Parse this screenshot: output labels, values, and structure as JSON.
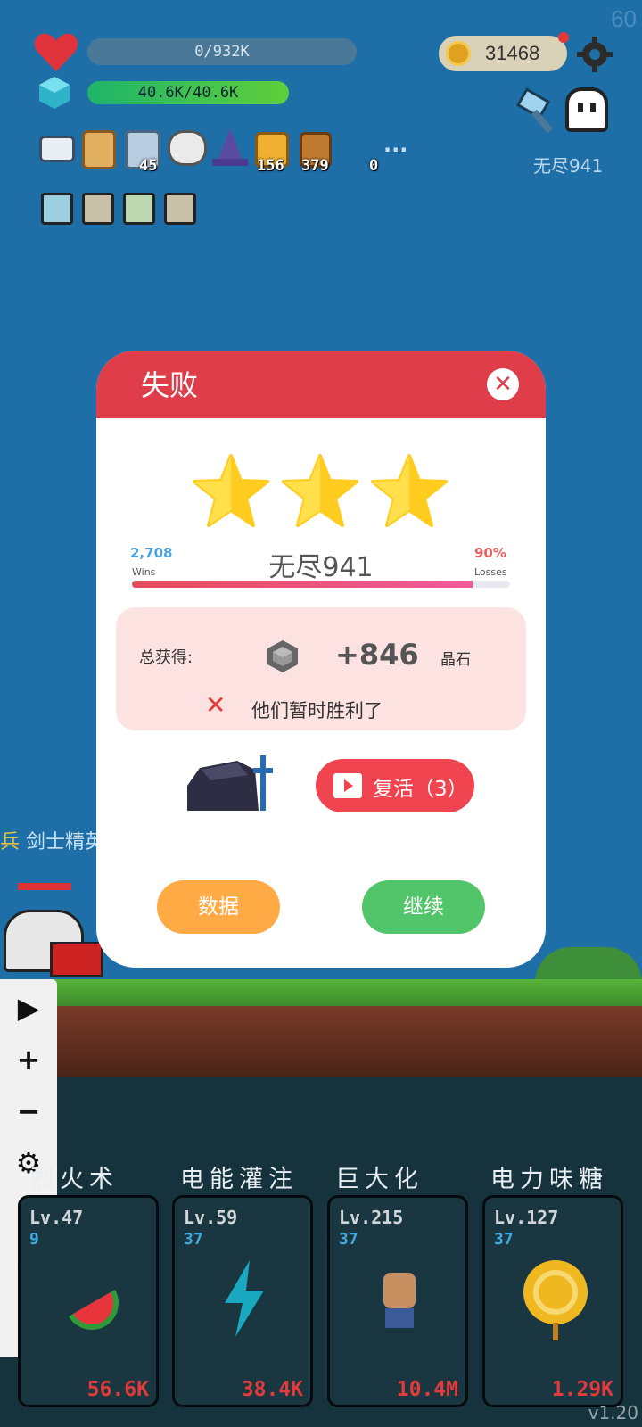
{
  "hud": {
    "fps": "60",
    "hp": "0/932K",
    "mana": "40.6K/40.6K",
    "coins": "31468",
    "stage": "无尽941",
    "item_counts": [
      "45",
      "156",
      "379",
      "0"
    ],
    "more_label": "..."
  },
  "enemy_label": {
    "prefix": "兵",
    "name": "剑士精英"
  },
  "toolbar": [
    "play-icon",
    "plus-icon",
    "minus-icon",
    "gear-icon",
    "eye-icon",
    "move-icon",
    "close-icon"
  ],
  "modal": {
    "title": "失败",
    "close_icon": "close-icon",
    "stars": 3,
    "wins": "2,708",
    "wins_label": "Wins",
    "losses": "90%",
    "losses_label": "Losses",
    "stage": "无尽941",
    "progress": 0.9,
    "reward_label": "总获得:",
    "reward_amount": "+846",
    "reward_unit": "晶石",
    "message": "他们暂时胜利了",
    "revive_label": "复活（3）",
    "data_button": "数据",
    "continue_button": "继续"
  },
  "skills": [
    {
      "name": "烈火术",
      "level": "Lv.47",
      "sub": "9",
      "value": "56.6K",
      "icon": "watermelon-icon"
    },
    {
      "name": "电能灌注",
      "level": "Lv.59",
      "sub": "37",
      "value": "38.4K",
      "icon": "lightning-icon"
    },
    {
      "name": "巨大化",
      "level": "Lv.215",
      "sub": "37",
      "value": "10.4M",
      "icon": "fist-icon"
    },
    {
      "name": "电力味糖",
      "level": "Lv.127",
      "sub": "37",
      "value": "1.29K",
      "icon": "lollipop-icon"
    }
  ],
  "version": "v1.20",
  "colors": {
    "sky": "#1e6fa8",
    "header_red": "#df3d4a",
    "reward_bg": "#fde2e2",
    "data_btn": "#ffaa44",
    "continue_btn": "#52c46a",
    "revive_btn": "#f04550",
    "star": "#ffcc1f"
  }
}
